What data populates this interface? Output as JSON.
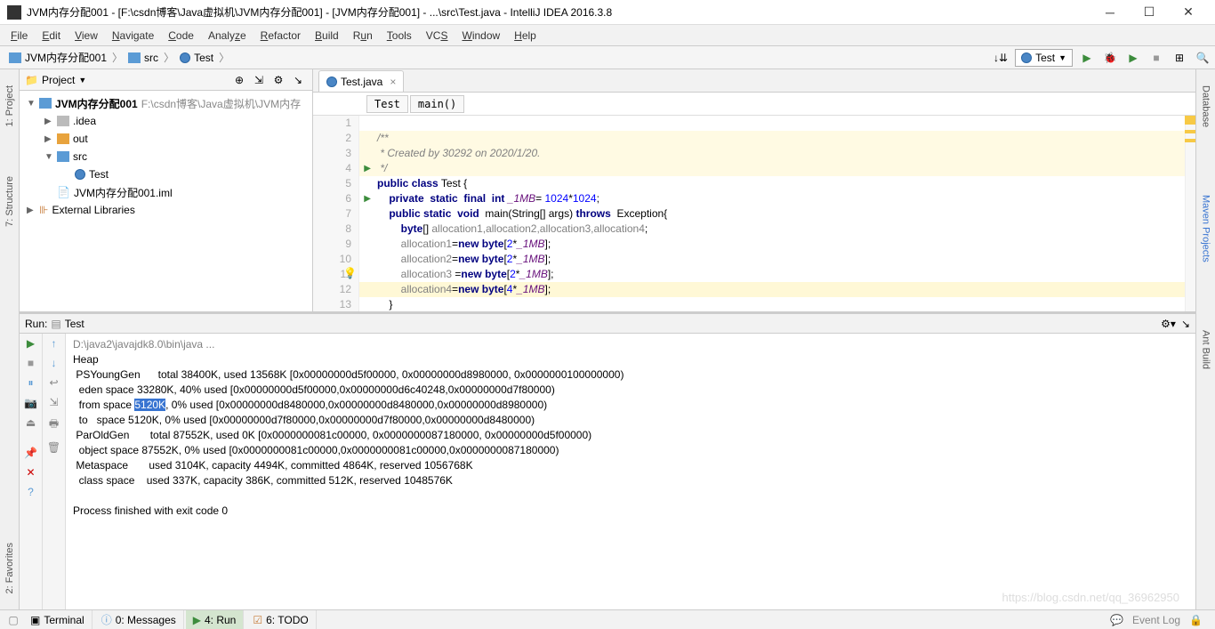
{
  "title": "JVM内存分配001 - [F:\\csdn博客\\Java虚拟机\\JVM内存分配001] - [JVM内存分配001] - ...\\src\\Test.java - IntelliJ IDEA 2016.3.8",
  "menu": [
    "File",
    "Edit",
    "View",
    "Navigate",
    "Code",
    "Analyze",
    "Refactor",
    "Build",
    "Run",
    "Tools",
    "VCS",
    "Window",
    "Help"
  ],
  "breadcrumb": {
    "root": "JVM内存分配001",
    "folder": "src",
    "file": "Test"
  },
  "runconfig": "Test",
  "project_panel": {
    "title": "Project"
  },
  "tree": {
    "root": "JVM内存分配001",
    "root_path": "F:\\csdn博客\\Java虚拟机\\JVM内存",
    "idea": ".idea",
    "out": "out",
    "src": "src",
    "test": "Test",
    "iml": "JVM内存分配001.iml",
    "ext": "External Libraries"
  },
  "tab": {
    "name": "Test.java"
  },
  "crumbs": {
    "class": "Test",
    "method": "main()"
  },
  "code": {
    "l1": "/**",
    "l2": " * Created by 30292 on 2020/1/20.",
    "l3": " */",
    "l4a": "public",
    "l4b": "class",
    "l4c": "Test {",
    "l5a": "private",
    "l5b": "static",
    "l5c": "final",
    "l5d": "int",
    "l5e": "_1MB",
    "l5f": "=",
    "l5g": "1024",
    "l5h": "*",
    "l5i": "1024",
    "l5j": ";",
    "l6a": "public",
    "l6b": "static",
    "l6c": "void",
    "l6d": "main(String[] args)",
    "l6e": "throws",
    "l6f": "Exception{",
    "l7a": "byte",
    "l7b": "[]",
    "l7c": "allocation1,allocation2,allocation3,allocation4",
    "l7d": ";",
    "l8a": "allocation1",
    "l8b": "=",
    "l8c": "new",
    "l8d": "byte",
    "l8e": "[",
    "l8f": "2",
    "l8g": "*",
    "l8h": "_1MB",
    "l8i": "];",
    "l9a": "allocation2",
    "l9b": "=",
    "l9c": "new",
    "l9d": "byte",
    "l9e": "[",
    "l9f": "2",
    "l9g": "*",
    "l9h": "_1MB",
    "l9i": "];",
    "l10a": "allocation3",
    "l10b": " =",
    "l10c": "new",
    "l10d": "byte",
    "l10e": "[",
    "l10f": "2",
    "l10g": "*",
    "l10h": "_1MB",
    "l10i": "];",
    "l11a": "allocation4",
    "l11b": "=",
    "l11c": "new",
    "l11d": "byte",
    "l11e": "[",
    "l11f": "4",
    "l11g": "*",
    "l11h": "_1MB",
    "l11i": "];",
    "l12": "}",
    "l13": "}"
  },
  "run_tab": {
    "label_run": "Run:",
    "label_test": "Test"
  },
  "console": {
    "cmd": "D:\\java2\\javajdk8.0\\bin\\java ...",
    "l2": "Heap",
    "l3": " PSYoungGen      total 38400K, used 13568K [0x00000000d5f00000, 0x00000000d8980000, 0x0000000100000000)",
    "l4": "  eden space 33280K, 40% used [0x00000000d5f00000,0x00000000d6c40248,0x00000000d7f80000)",
    "l5a": "  from space ",
    "l5sel": "5120K",
    "l5b": ", 0% used [0x00000000d8480000,0x00000000d8480000,0x00000000d8980000)",
    "l6": "  to   space 5120K, 0% used [0x00000000d7f80000,0x00000000d7f80000,0x00000000d8480000)",
    "l7": " ParOldGen       total 87552K, used 0K [0x0000000081c00000, 0x0000000087180000, 0x00000000d5f00000)",
    "l8": "  object space 87552K, 0% used [0x0000000081c00000,0x0000000081c00000,0x0000000087180000)",
    "l9": " Metaspace       used 3104K, capacity 4494K, committed 4864K, reserved 1056768K",
    "l10": "  class space    used 337K, capacity 386K, committed 512K, reserved 1048576K",
    "exit": "Process finished with exit code 0"
  },
  "status": {
    "terminal": "Terminal",
    "messages": "0: Messages",
    "run": "4: Run",
    "todo": "6: TODO",
    "eventlog": "Event Log"
  },
  "left_tools": {
    "project": "1: Project",
    "structure": "7: Structure",
    "favorites": "2: Favorites"
  },
  "right_tools": {
    "database": "Database",
    "maven": "Maven Projects",
    "ant": "Ant Build"
  },
  "watermark": "https://blog.csdn.net/qq_36962950"
}
